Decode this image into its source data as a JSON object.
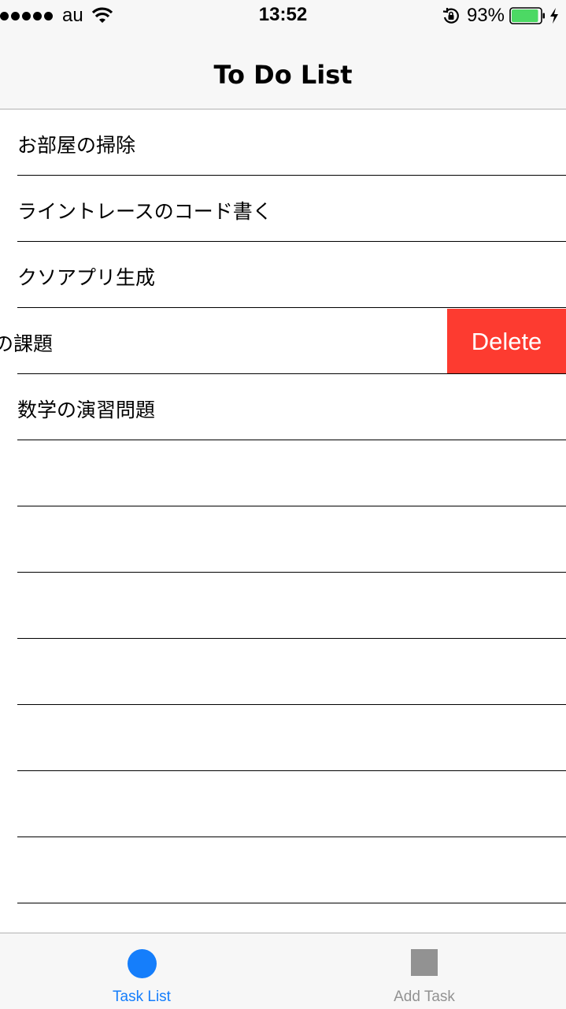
{
  "status_bar": {
    "carrier": "au",
    "time": "13:52",
    "battery_percent": "93%",
    "battery_level": 0.93,
    "battery_color": "#4cd964"
  },
  "nav": {
    "title": "To Do List"
  },
  "tasks": [
    "お部屋の掃除",
    "ライントレースのコード書く",
    "クソアプリ生成",
    "の課題",
    "数学の演習問題"
  ],
  "swipe": {
    "delete_label": "Delete",
    "delete_color": "#fd3b30"
  },
  "tabs": [
    {
      "label": "Task List",
      "icon": "circle-icon",
      "active": true,
      "color": "#157efb"
    },
    {
      "label": "Add Task",
      "icon": "square-icon",
      "active": false,
      "color": "#929292"
    }
  ]
}
